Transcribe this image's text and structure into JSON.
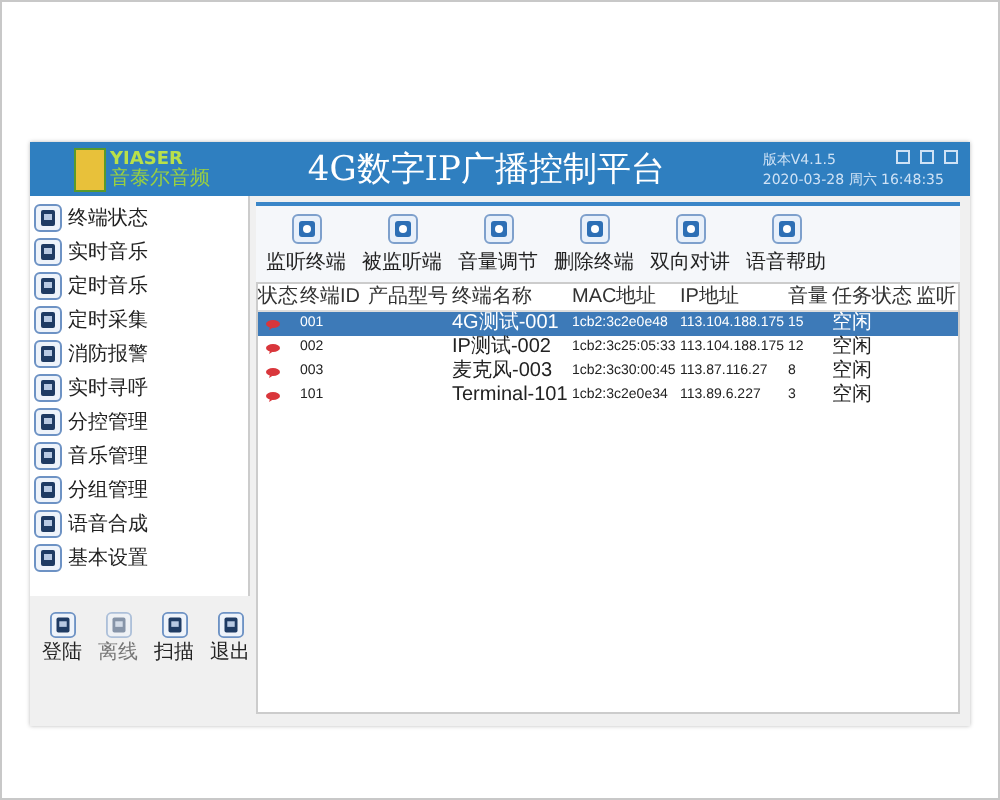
{
  "window": {
    "logo_text": "YIASER",
    "logo_subtitle": "音泰尔音频",
    "title": "4G数字IP广播控制平台",
    "version": "版本V4.1.5",
    "datetime": "2020-03-28 周六 16:48:35"
  },
  "sidebar": {
    "items": [
      {
        "label": "终端状态",
        "selected": false
      },
      {
        "label": "实时音乐",
        "selected": false
      },
      {
        "label": "定时音乐",
        "selected": false
      },
      {
        "label": "定时采集",
        "selected": false
      },
      {
        "label": "消防报警",
        "selected": false
      },
      {
        "label": "实时寻呼",
        "selected": false
      },
      {
        "label": "分控管理",
        "selected": false
      },
      {
        "label": "音乐管理",
        "selected": false
      },
      {
        "label": "分组管理",
        "selected": false
      },
      {
        "label": "语音合成",
        "selected": false
      },
      {
        "label": "基本设置",
        "selected": false
      }
    ]
  },
  "bottom_buttons": [
    {
      "label": "登陆",
      "disabled": false
    },
    {
      "label": "离线",
      "disabled": true
    },
    {
      "label": "扫描",
      "disabled": false
    },
    {
      "label": "退出",
      "disabled": false
    }
  ],
  "toolbar": [
    "监听终端",
    "被监听端",
    "音量调节",
    "删除终端",
    "双向对讲",
    "语音帮助"
  ],
  "table": {
    "columns": [
      "状态",
      "终端ID",
      "产品型号",
      "终端名称",
      "MAC地址",
      "IP地址",
      "音量",
      "任务状态",
      "监听"
    ],
    "rows": [
      {
        "id": "001",
        "name": "4G测试-001",
        "mac": "1cb2:3c2e0e48",
        "ip": "113.104.188.175",
        "volume": "15",
        "task": "空闲",
        "selected": true
      },
      {
        "id": "002",
        "name": "IP测试-002",
        "mac": "1cb2:3c25:05:33",
        "ip": "113.104.188.175",
        "volume": "12",
        "task": "空闲",
        "selected": false
      },
      {
        "id": "003",
        "name": "麦克风-003",
        "mac": "1cb2:3c30:00:45",
        "ip": "113.87.116.27",
        "volume": "8",
        "task": "空闲",
        "selected": false
      },
      {
        "id": "101",
        "name": "Terminal-101",
        "mac": "1cb2:3c2e0e34",
        "ip": "113.89.6.227",
        "volume": "3",
        "task": "空闲",
        "selected": false
      }
    ]
  }
}
